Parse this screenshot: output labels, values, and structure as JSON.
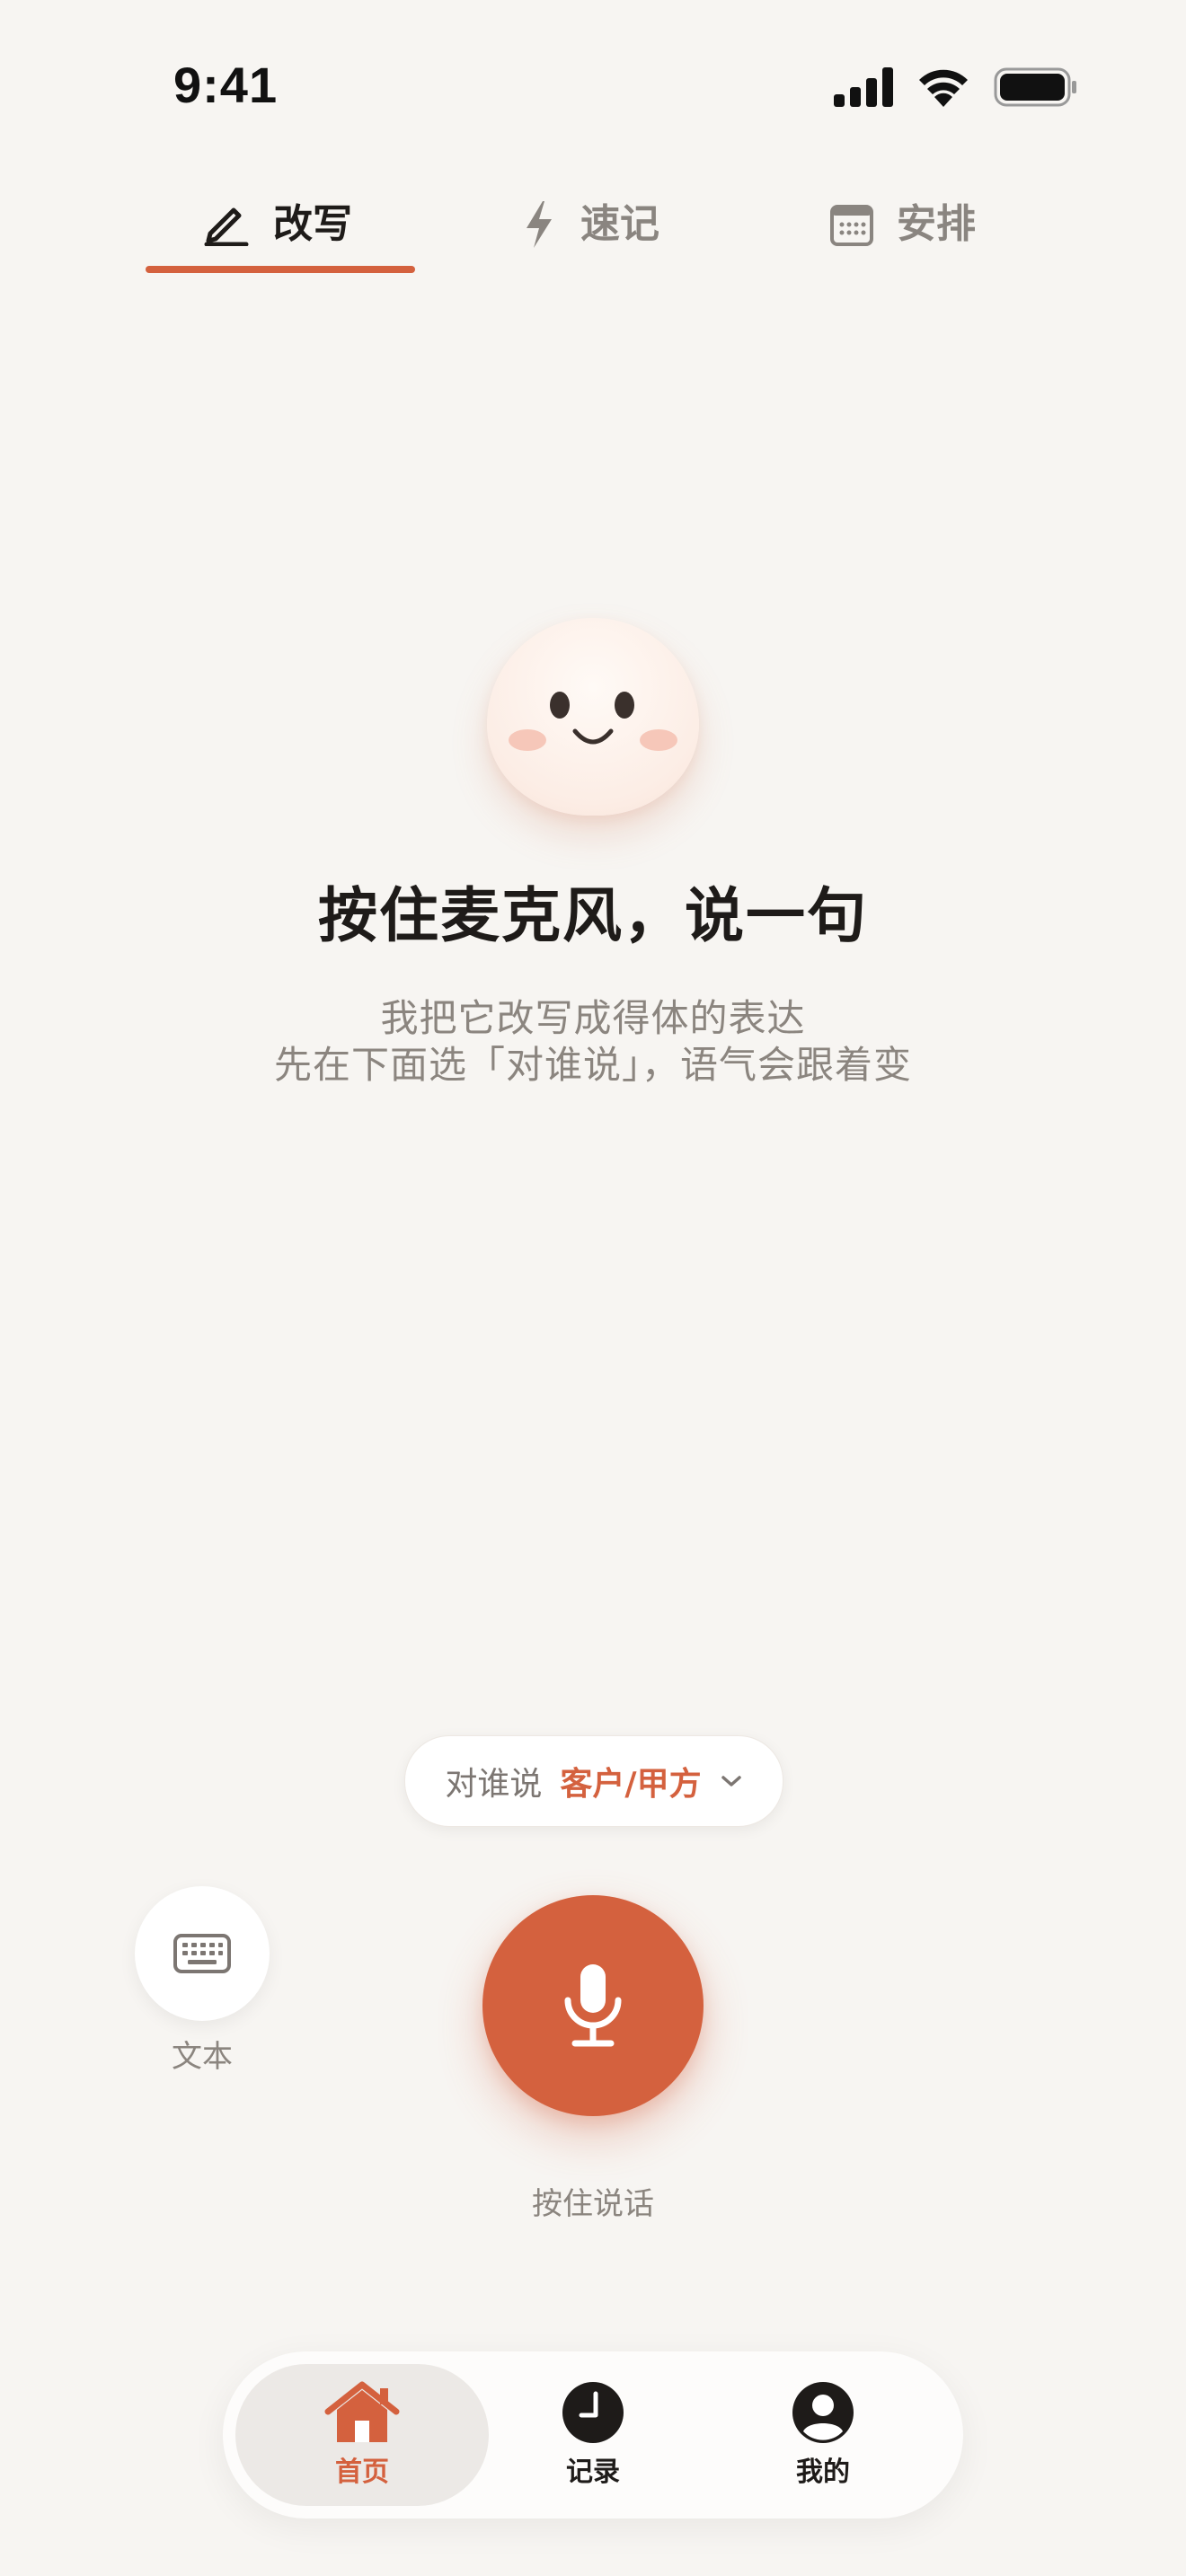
{
  "status_bar": {
    "time": "9:41"
  },
  "tabs": [
    {
      "label": "改写",
      "icon": "pen-icon",
      "active": true
    },
    {
      "label": "速记",
      "icon": "lightning-icon",
      "active": false
    },
    {
      "label": "安排",
      "icon": "calendar-icon",
      "active": false
    }
  ],
  "hero": {
    "title": "按住麦克风，说一句",
    "subtitle_line1": "我把它改写成得体的表达",
    "subtitle_line2": "先在下面选「对谁说」，语气会跟着变"
  },
  "audience": {
    "label": "对谁说",
    "value": "客户/甲方"
  },
  "keyboard_button": {
    "label": "文本"
  },
  "mic_button": {
    "label": "按住说话"
  },
  "bottom_nav": [
    {
      "label": "首页",
      "icon": "home-icon",
      "active": true
    },
    {
      "label": "记录",
      "icon": "clock-icon",
      "active": false
    },
    {
      "label": "我的",
      "icon": "profile-icon",
      "active": false
    }
  ],
  "colors": {
    "accent": "#D4613E",
    "background": "#F7F5F2",
    "text_primary": "#1E1B19",
    "text_secondary": "#8B857F"
  }
}
